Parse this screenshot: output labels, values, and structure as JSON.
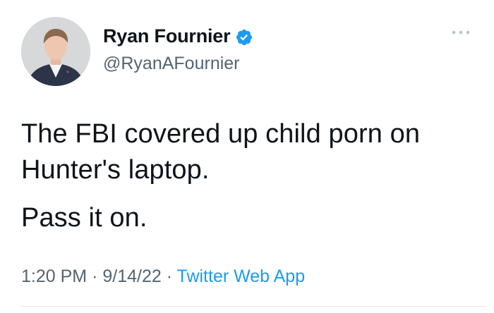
{
  "user": {
    "display_name": "Ryan Fournier",
    "handle": "@RyanAFournier",
    "verified": true
  },
  "tweet": {
    "line1": "The FBI covered up child porn on Hunter's laptop.",
    "line2": "Pass it on.",
    "time": "1:20 PM",
    "date": "9/14/22",
    "source": "Twitter Web App",
    "separator": "·"
  },
  "icons": {
    "verified": "verified-badge-icon",
    "more": "more-options-icon"
  },
  "colors": {
    "text": "#0f1419",
    "muted": "#536471",
    "accent": "#1d9bf0"
  }
}
